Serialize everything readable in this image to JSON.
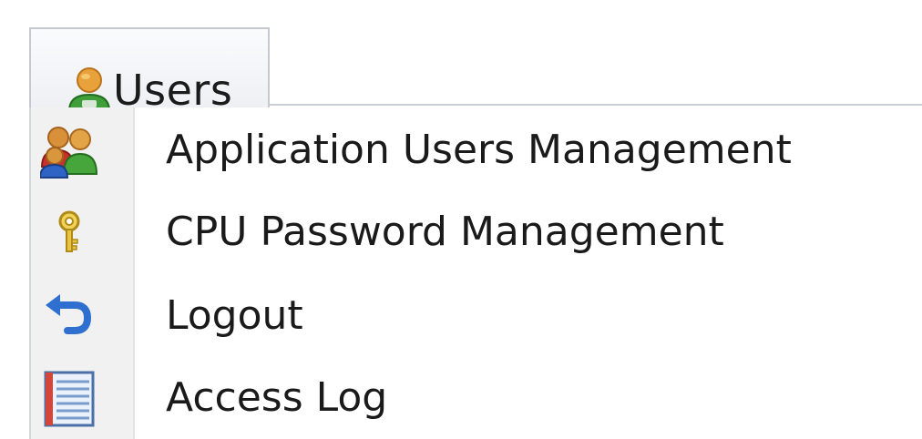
{
  "menu_bar": {
    "tab": {
      "label": "Users",
      "icon": "user-icon"
    }
  },
  "dropdown": {
    "items": [
      {
        "label": "Application Users Management",
        "icon": "users-group-icon"
      },
      {
        "label": "CPU Password Management",
        "icon": "key-icon"
      },
      {
        "label": "Logout",
        "icon": "logout-undo-icon"
      },
      {
        "label": "Access Log",
        "icon": "log-list-icon"
      }
    ]
  },
  "colors": {
    "tab_border": "#c6c9ce",
    "gutter": "#f1f1f1",
    "text": "#1a1a1a"
  }
}
